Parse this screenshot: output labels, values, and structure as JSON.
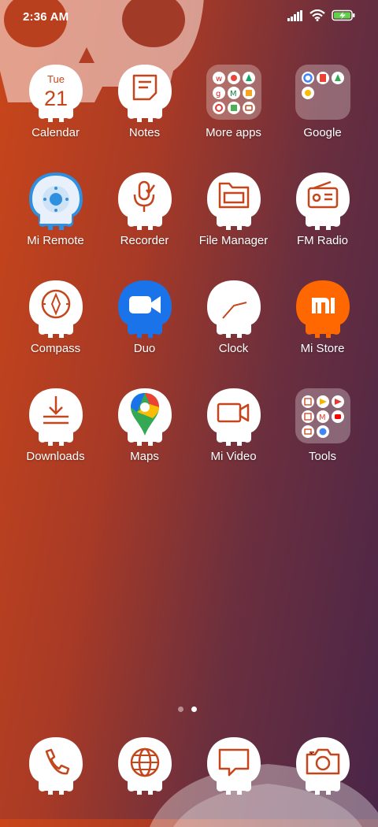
{
  "status_bar": {
    "time": "2:36 AM",
    "icons": [
      "signal-icon",
      "wifi-icon",
      "battery-charging-icon"
    ]
  },
  "apps": [
    {
      "id": "calendar",
      "label": "Calendar",
      "day_name": "Tue",
      "day_number": "21"
    },
    {
      "id": "notes",
      "label": "Notes"
    },
    {
      "id": "more-apps",
      "label": "More apps"
    },
    {
      "id": "google",
      "label": "Google"
    },
    {
      "id": "mi-remote",
      "label": "Mi Remote"
    },
    {
      "id": "recorder",
      "label": "Recorder"
    },
    {
      "id": "file-manager",
      "label": "File Manager"
    },
    {
      "id": "fm-radio",
      "label": "FM Radio"
    },
    {
      "id": "compass",
      "label": "Compass"
    },
    {
      "id": "duo",
      "label": "Duo"
    },
    {
      "id": "clock",
      "label": "Clock"
    },
    {
      "id": "mi-store",
      "label": "Mi Store",
      "logo_text": "mi"
    },
    {
      "id": "downloads",
      "label": "Downloads"
    },
    {
      "id": "maps",
      "label": "Maps"
    },
    {
      "id": "mi-video",
      "label": "Mi Video"
    },
    {
      "id": "tools",
      "label": "Tools"
    }
  ],
  "page_indicator": {
    "pages": 2,
    "current": 2
  },
  "dock": [
    {
      "id": "phone",
      "icon": "phone-icon"
    },
    {
      "id": "browser",
      "icon": "globe-icon"
    },
    {
      "id": "messages",
      "icon": "message-icon"
    },
    {
      "id": "camera",
      "icon": "camera-icon"
    }
  ],
  "colors": {
    "accent": "#c4461c",
    "skull": "#ffffff",
    "wallpaper_left": "#c9461a",
    "wallpaper_right": "#4a2548"
  }
}
